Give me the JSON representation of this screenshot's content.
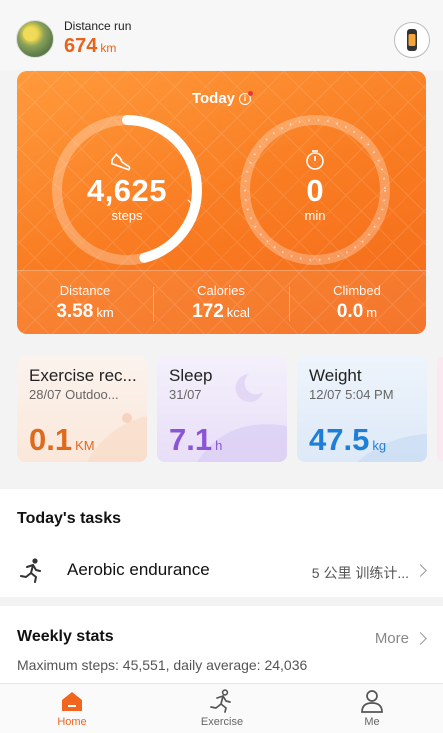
{
  "header": {
    "distance_label": "Distance run",
    "distance_value": "674",
    "distance_unit": "km",
    "device_icon": "band-icon"
  },
  "today": {
    "title": "Today",
    "steps": "4,625",
    "steps_label": "steps",
    "steps_progress": 0.46,
    "minutes": "0",
    "minutes_label": "min",
    "metrics": [
      {
        "label": "Distance",
        "value": "3.58",
        "unit": "km"
      },
      {
        "label": "Calories",
        "value": "172",
        "unit": "kcal"
      },
      {
        "label": "Climbed",
        "value": "0.0",
        "unit": "m"
      }
    ]
  },
  "cards": [
    {
      "title": "Exercise rec...",
      "sub": "28/07 Outdoo...",
      "value": "0.1",
      "unit": "KM",
      "color": "#e06a1c"
    },
    {
      "title": "Sleep",
      "sub": "31/07",
      "value": "7.1",
      "unit": "h",
      "color": "#8a55d6"
    },
    {
      "title": "Weight",
      "sub": "12/07 5:04 PM",
      "value": "47.5",
      "unit": "kg",
      "color": "#1f7fd8"
    }
  ],
  "tasks": {
    "title": "Today's tasks",
    "items": [
      {
        "name": "Aerobic endurance",
        "plan": "5 公里 训练计...",
        "icon": "running-icon"
      }
    ]
  },
  "weekly": {
    "title": "Weekly stats",
    "more": "More",
    "summary": "Maximum steps: 45,551, daily average: 24,036"
  },
  "nav": {
    "items": [
      {
        "label": "Home",
        "icon": "home-icon",
        "active": true
      },
      {
        "label": "Exercise",
        "icon": "exercise-icon",
        "active": false
      },
      {
        "label": "Me",
        "icon": "person-icon",
        "active": false
      }
    ]
  },
  "colors": {
    "accent": "#f0661f",
    "card_orange": "#f97c22"
  }
}
